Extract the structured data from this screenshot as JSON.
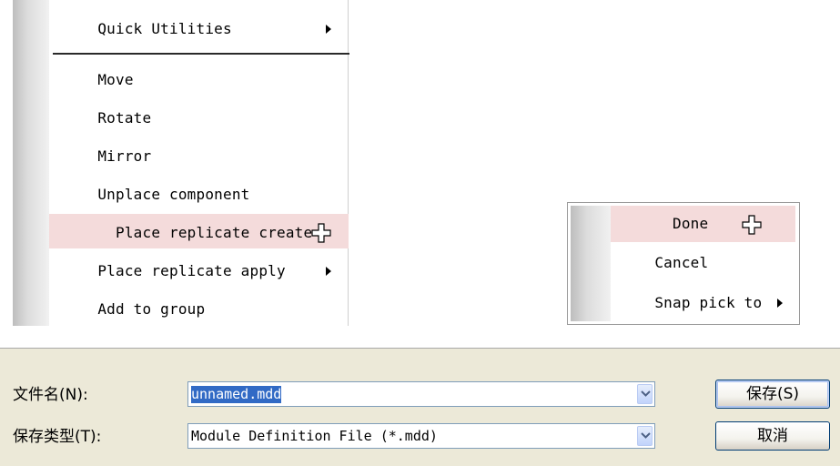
{
  "menu_primary": {
    "items": [
      {
        "label": "Quick Utilities",
        "submenu": true
      },
      {
        "label": "Move",
        "submenu": false
      },
      {
        "label": "Rotate",
        "submenu": false
      },
      {
        "label": "Mirror",
        "submenu": false
      },
      {
        "label": "Unplace component",
        "submenu": false
      },
      {
        "label": "Place replicate create",
        "submenu": false,
        "highlighted": true
      },
      {
        "label": "Place replicate apply",
        "submenu": true
      },
      {
        "label": "Add to group",
        "submenu": false
      }
    ]
  },
  "menu_secondary": {
    "items": [
      {
        "label": "Done",
        "submenu": false,
        "highlighted": true
      },
      {
        "label": "Cancel",
        "submenu": false
      },
      {
        "label": "Snap pick to",
        "submenu": true
      }
    ]
  },
  "dialog": {
    "filename_label": "文件名(N):",
    "filename_value": "unnamed.mdd",
    "filetype_label": "保存类型(T):",
    "filetype_value": "Module Definition File (*.mdd)",
    "save_button": "保存(S)",
    "cancel_button": "取消"
  },
  "icons": {
    "cursor": "crosshair-cursor-icon",
    "submenu": "submenu-arrow-icon",
    "dropdown": "chevron-down-icon"
  },
  "colors": {
    "highlight": "#f4dbdb",
    "dialog_bg": "#ece9d8",
    "selection": "#316ac5",
    "button_border": "#003c74"
  }
}
